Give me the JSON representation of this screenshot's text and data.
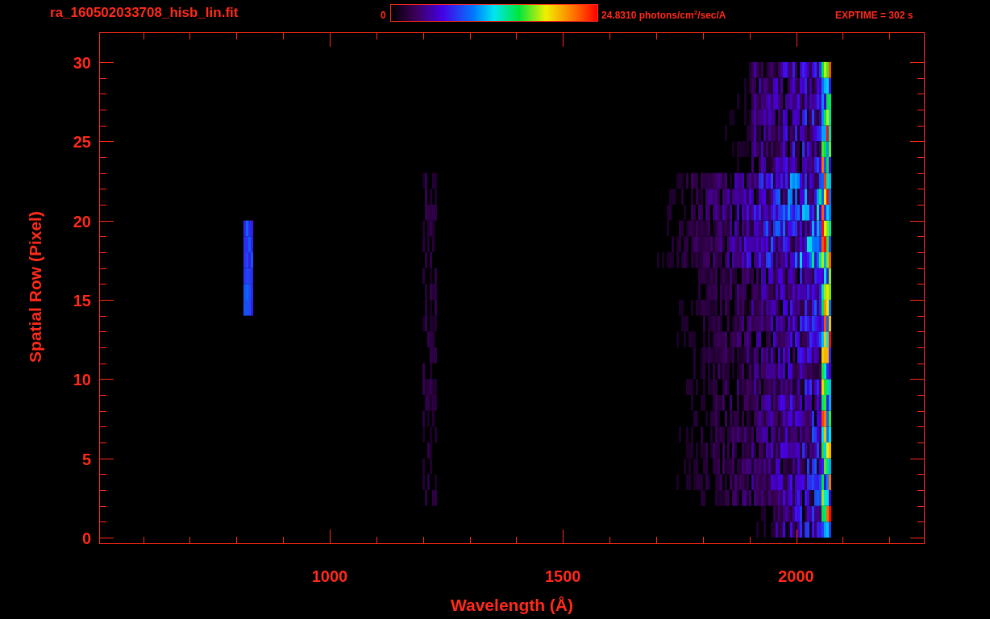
{
  "header": {
    "file_name": "ra_160502033708_hisb_lin.fit",
    "colorbar_min": "0",
    "colorbar_max": "24.8310 photons/cm$^{2}$/sec/A",
    "exposure": "EXPTIME = 302 s"
  },
  "plot": {
    "x_axis_label": "Wavelength (Å)",
    "y_axis_label": "Spatial Row (Pixel)",
    "x_tick_labels": [
      "1000",
      "1500",
      "2000"
    ],
    "y_tick_labels": [
      "30",
      "25",
      "20",
      "15",
      "10",
      "5",
      "0"
    ]
  }
}
